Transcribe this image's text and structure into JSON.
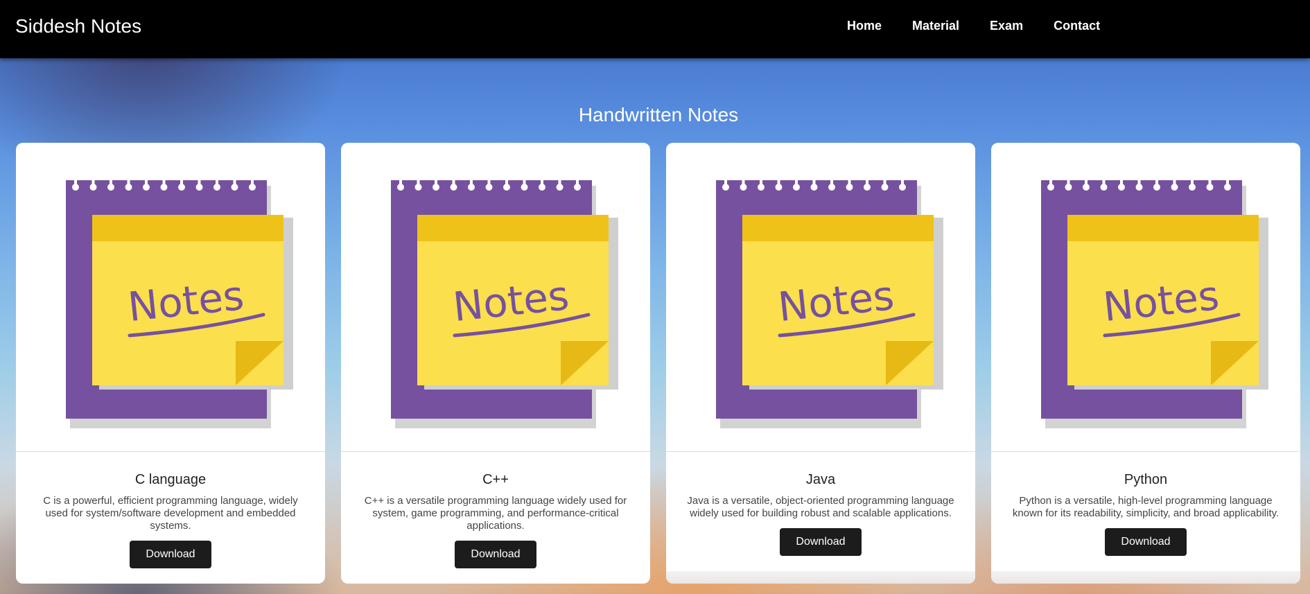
{
  "nav": {
    "brand": "Siddesh Notes",
    "links": [
      "Home",
      "Material",
      "Exam",
      "Contact"
    ]
  },
  "section": {
    "title": "Handwritten Notes"
  },
  "cards": [
    {
      "title": "C language",
      "text": "C is a powerful, efficient programming language, widely used for system/software development and embedded systems.",
      "button": "Download",
      "image_text": "Notes"
    },
    {
      "title": "C++",
      "text": "C++ is a versatile programming language widely used for system, game programming, and performance-critical applications.",
      "button": "Download",
      "image_text": "Notes"
    },
    {
      "title": "Java",
      "text": "Java is a versatile, object-oriented programming language widely used for building robust and scalable applications.",
      "button": "Download",
      "image_text": "Notes"
    },
    {
      "title": "Python",
      "text": "Python is a versatile, high-level programming language known for its readability, simplicity, and broad applicability.",
      "button": "Download",
      "image_text": "Notes"
    }
  ],
  "colors": {
    "notebook_purple": "#76519f",
    "sticky_yellow": "#fbdf4c",
    "sticky_top": "#efc219",
    "button_bg": "#1c1c1c"
  }
}
